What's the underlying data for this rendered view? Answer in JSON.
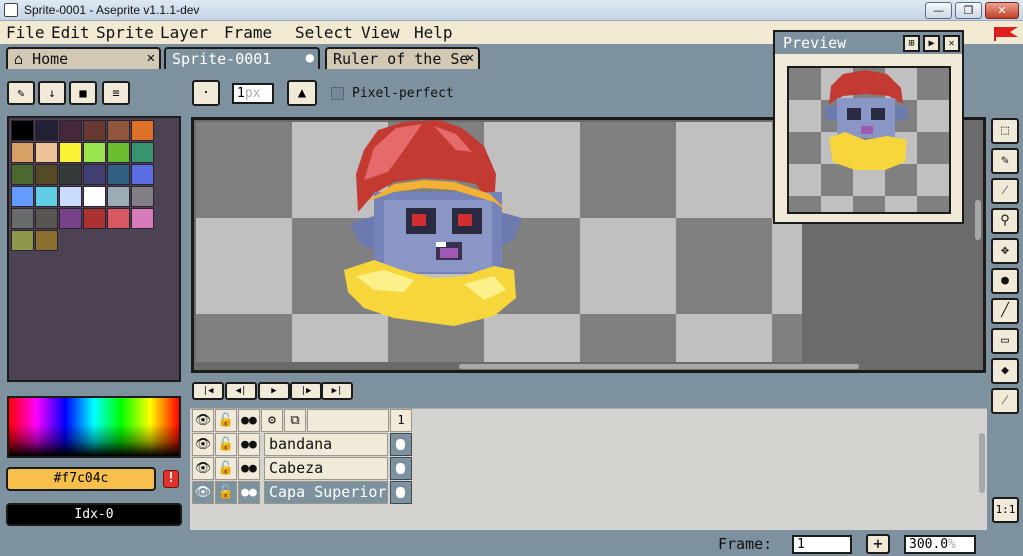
{
  "window": {
    "title": "Sprite-0001 - Aseprite v1.1.1-dev",
    "buttons": {
      "minimize": "—",
      "maximize": "❐",
      "close": "✕"
    }
  },
  "menu": {
    "items": [
      {
        "label": "File"
      },
      {
        "label": "Edit"
      },
      {
        "label": "Sprite"
      },
      {
        "label": "Layer"
      },
      {
        "label": "Frame"
      },
      {
        "label": "Select"
      },
      {
        "label": "View"
      },
      {
        "label": "Help"
      }
    ]
  },
  "tabs": [
    {
      "label": "Home",
      "close": "✕"
    },
    {
      "label": "Sprite-0001",
      "close": "●"
    },
    {
      "label": "Ruler of the Se",
      "close": "✕"
    }
  ],
  "palette": {
    "colors": [
      "#000000",
      "#222034",
      "#45283c",
      "#663931",
      "#8f563b",
      "#df7126",
      "#d9a066",
      "#eec39a",
      "#fbf236",
      "#99e550",
      "#6abe30",
      "#37946e",
      "#4b692f",
      "#524b24",
      "#323c39",
      "#3f3f74",
      "#306082",
      "#5b6ee1",
      "#639bff",
      "#5fcde4",
      "#cbdbfc",
      "#ffffff",
      "#9badb7",
      "#847e87",
      "#696a6a",
      "#595652",
      "#76428a",
      "#ac3232",
      "#d95763",
      "#d77bba",
      "#8f974a",
      "#8a6f30"
    ]
  },
  "colors": {
    "foreground": "#f7c04c",
    "foreground_label": "#f7c04c",
    "background_label": "Idx-0",
    "warning": "!"
  },
  "context_bar": {
    "brush_size": "1",
    "brush_unit": "px",
    "pixel_perfect_label": "Pixel-perfect"
  },
  "preview": {
    "title": "Preview"
  },
  "timeline": {
    "frame_header": "1",
    "layers": [
      {
        "name": "bandana",
        "selected": false
      },
      {
        "name": "Cabeza",
        "selected": false
      },
      {
        "name": "Capa Superior",
        "selected": true
      }
    ]
  },
  "status": {
    "frame_label": "Frame:",
    "frame_value": "1",
    "add_frame": "+",
    "zoom_value": "300.0",
    "zoom_unit": "%",
    "one_to_one": "1:1"
  }
}
